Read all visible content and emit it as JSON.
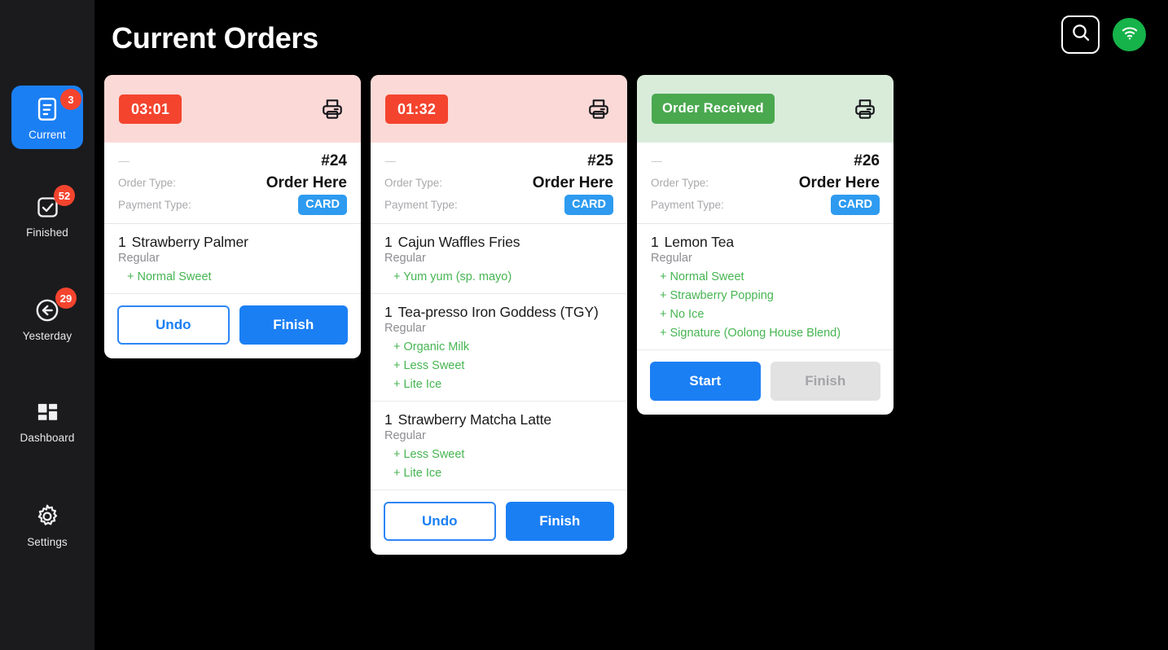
{
  "header": {
    "title": "Current Orders",
    "search_icon": "search-icon",
    "wifi_icon": "wifi-icon"
  },
  "sidebar": {
    "items": [
      {
        "label": "Current",
        "badge": "3",
        "icon": "document-icon",
        "active": true
      },
      {
        "label": "Finished",
        "badge": "52",
        "icon": "check-square-icon",
        "active": false
      },
      {
        "label": "Yesterday",
        "badge": "29",
        "icon": "arrow-left-circle-icon",
        "active": false
      },
      {
        "label": "Dashboard",
        "badge": "",
        "icon": "grid-icon",
        "active": false
      },
      {
        "label": "Settings",
        "badge": "",
        "icon": "gear-icon",
        "active": false
      }
    ]
  },
  "labels": {
    "order_type": "Order Type:",
    "payment_type": "Payment Type:",
    "dashes": "----",
    "print_icon": "printer-icon"
  },
  "orders": [
    {
      "status": "03:01",
      "status_kind": "timer",
      "number": "#24",
      "order_type": "Order Here",
      "payment_type": "CARD",
      "items": [
        {
          "qty": "1",
          "name": "Strawberry Palmer",
          "size": "Regular",
          "options": [
            "+ Normal Sweet"
          ]
        }
      ],
      "buttons": [
        {
          "label": "Undo",
          "style": "outline"
        },
        {
          "label": "Finish",
          "style": "primary"
        }
      ]
    },
    {
      "status": "01:32",
      "status_kind": "timer",
      "number": "#25",
      "order_type": "Order Here",
      "payment_type": "CARD",
      "items": [
        {
          "qty": "1",
          "name": "Cajun Waffles Fries",
          "size": "Regular",
          "options": [
            "+ Yum yum (sp. mayo)"
          ]
        },
        {
          "qty": "1",
          "name": "Tea-presso Iron Goddess (TGY)",
          "size": "Regular",
          "options": [
            "+ Organic Milk",
            "+ Less Sweet",
            "+ Lite Ice"
          ]
        },
        {
          "qty": "1",
          "name": "Strawberry Matcha Latte",
          "size": "Regular",
          "options": [
            "+ Less Sweet",
            "+ Lite Ice"
          ]
        }
      ],
      "buttons": [
        {
          "label": "Undo",
          "style": "outline"
        },
        {
          "label": "Finish",
          "style": "primary"
        }
      ]
    },
    {
      "status": "Order Received",
      "status_kind": "ok",
      "number": "#26",
      "order_type": "Order Here",
      "payment_type": "CARD",
      "items": [
        {
          "qty": "1",
          "name": "Lemon Tea",
          "size": "Regular",
          "options": [
            "+ Normal Sweet",
            "+ Strawberry Popping",
            "+ No Ice",
            "+ Signature (Oolong House Blend)"
          ]
        }
      ],
      "buttons": [
        {
          "label": "Start",
          "style": "primary"
        },
        {
          "label": "Finish",
          "style": "disabled"
        }
      ]
    }
  ],
  "colors": {
    "accent_blue": "#1b7ff4",
    "danger_red": "#f4442e",
    "success_green": "#4aa84f",
    "option_green": "#46b552",
    "card_chip_blue": "#2e9bf0",
    "pending_head": "#fbd9d6",
    "received_head": "#d9ecda",
    "sidebar_bg": "#1b1b1d",
    "page_bg": "#000000"
  }
}
